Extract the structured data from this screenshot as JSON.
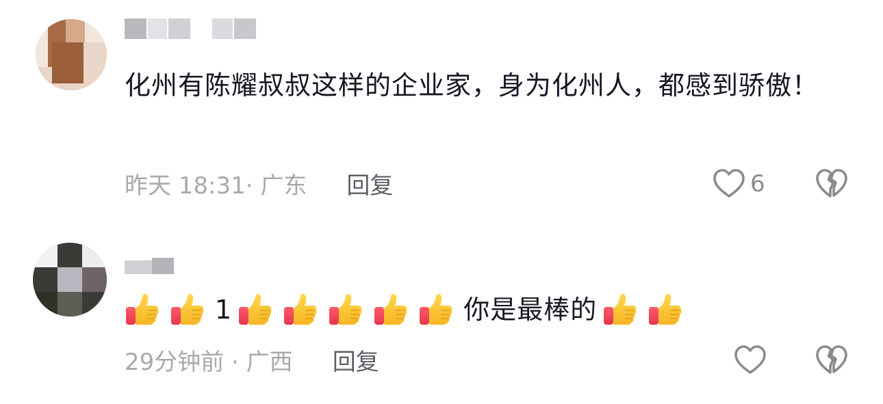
{
  "comments": [
    {
      "text": "化州有陈耀叔叔这样的企业家，身为化州人，都感到骄傲！",
      "time_location": "昨天 18:31· 广东",
      "reply_label": "回复",
      "like_count": "6"
    },
    {
      "text_parts": [
        "1",
        "你是最棒的"
      ],
      "time_location": "29分钟前 · 广西",
      "reply_label": "回复",
      "like_count": ""
    }
  ],
  "icons": {
    "like": "heart-icon",
    "dislike": "broken-heart-icon",
    "emoji": "thumbs-up-emoji"
  },
  "colors": {
    "text": "#161823",
    "meta": "#a8a9ae",
    "reply": "#5d5e66",
    "icon": "#8a8b91"
  }
}
